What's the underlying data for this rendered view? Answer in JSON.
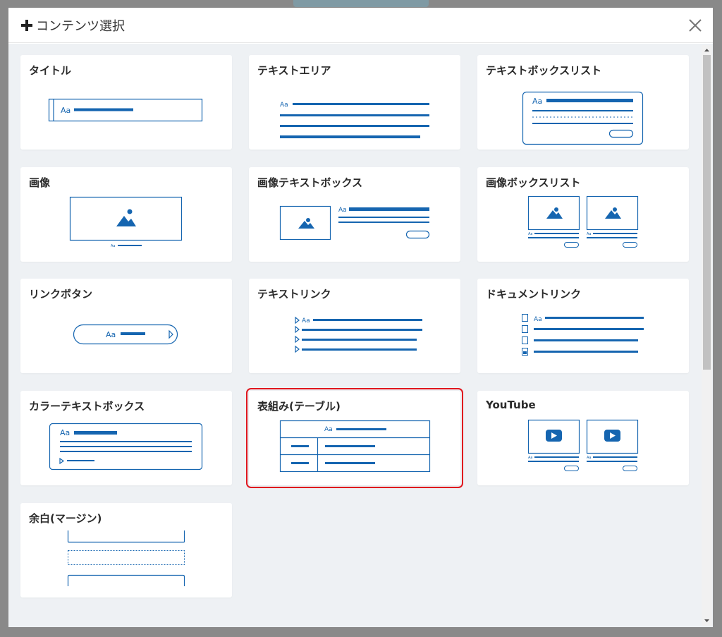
{
  "dialog": {
    "title": "コンテンツ選択",
    "plus_icon": "plus-icon",
    "close_icon": "close-icon"
  },
  "cards": [
    {
      "id": "title",
      "label": "タイトル"
    },
    {
      "id": "text-area",
      "label": "テキストエリア"
    },
    {
      "id": "text-box-list",
      "label": "テキストボックスリスト"
    },
    {
      "id": "image",
      "label": "画像"
    },
    {
      "id": "image-text-box",
      "label": "画像テキストボックス"
    },
    {
      "id": "image-box-list",
      "label": "画像ボックスリスト"
    },
    {
      "id": "link-button",
      "label": "リンクボタン"
    },
    {
      "id": "text-link",
      "label": "テキストリンク"
    },
    {
      "id": "document-link",
      "label": "ドキュメントリンク"
    },
    {
      "id": "color-text-box",
      "label": "カラーテキストボックス"
    },
    {
      "id": "table",
      "label": "表組み(テーブル)",
      "selected": true
    },
    {
      "id": "youtube",
      "label": "YouTube"
    },
    {
      "id": "margin",
      "label": "余白(マージン)"
    }
  ],
  "illustration": {
    "placeholder_text": "Aa"
  },
  "colors": {
    "accent": "#1565b0",
    "selection": "#e0161e",
    "background": "#eef1f4"
  }
}
